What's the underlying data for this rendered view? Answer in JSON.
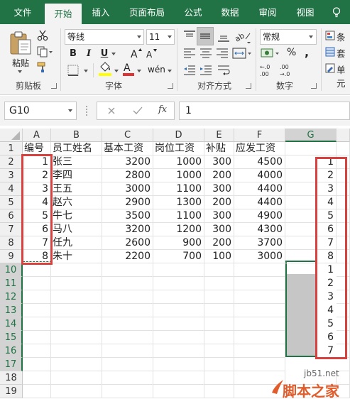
{
  "ribbon_tabs": [
    "文件",
    "开始",
    "插入",
    "页面布局",
    "公式",
    "数据",
    "审阅",
    "视图"
  ],
  "ribbon": {
    "clipboard": {
      "paste_label": "粘贴",
      "group_label": "剪贴板"
    },
    "font": {
      "font_name": "等线",
      "font_size": "11",
      "group_label": "字体",
      "font_color": "#e03030",
      "fill_color": "#ffff00"
    },
    "alignment": {
      "group_label": "对齐方式"
    },
    "number": {
      "format": "常规",
      "group_label": "数字"
    },
    "styles": {
      "items": [
        "条",
        "套",
        "单元"
      ]
    }
  },
  "formula_bar": {
    "name_box": "G10",
    "value": "1"
  },
  "grid": {
    "columns": [
      "A",
      "B",
      "C",
      "D",
      "E",
      "F",
      "G"
    ],
    "selected_column": "G",
    "selected_rows": [
      10,
      11,
      12,
      13,
      14,
      15,
      16,
      17
    ],
    "row_numbers": [
      1,
      2,
      3,
      4,
      5,
      6,
      7,
      8,
      9,
      10,
      11,
      12,
      13,
      14,
      15,
      16,
      17,
      18,
      19
    ],
    "headers": [
      "编号",
      "员工姓名",
      "基本工资",
      "岗位工资",
      "补贴",
      "应发工资"
    ],
    "rows": [
      {
        "id": "1",
        "name": "张三",
        "base": "3200",
        "post": "1000",
        "allowance": "300",
        "total": "4500",
        "g": "1"
      },
      {
        "id": "2",
        "name": "李四",
        "base": "2800",
        "post": "1000",
        "allowance": "200",
        "total": "4000",
        "g": "2"
      },
      {
        "id": "3",
        "name": "王五",
        "base": "3000",
        "post": "1100",
        "allowance": "300",
        "total": "4400",
        "g": "3"
      },
      {
        "id": "4",
        "name": "赵六",
        "base": "2900",
        "post": "1300",
        "allowance": "200",
        "total": "4400",
        "g": "4"
      },
      {
        "id": "5",
        "name": "牛七",
        "base": "3500",
        "post": "1100",
        "allowance": "300",
        "total": "4900",
        "g": "5"
      },
      {
        "id": "6",
        "name": "马八",
        "base": "3200",
        "post": "1200",
        "allowance": "300",
        "total": "4300",
        "g": "6"
      },
      {
        "id": "7",
        "name": "任九",
        "base": "2600",
        "post": "900",
        "allowance": "200",
        "total": "3700",
        "g": "7"
      },
      {
        "id": "8",
        "name": "朱十",
        "base": "2200",
        "post": "700",
        "allowance": "100",
        "total": "3000",
        "g": "8"
      }
    ],
    "g_pasted": [
      "1",
      "2",
      "3",
      "4",
      "5",
      "6",
      "7"
    ],
    "highlight_color": "#d9413e",
    "accent": "#217346"
  },
  "watermark": {
    "url": "jb51.net",
    "name": "脚本之家"
  }
}
